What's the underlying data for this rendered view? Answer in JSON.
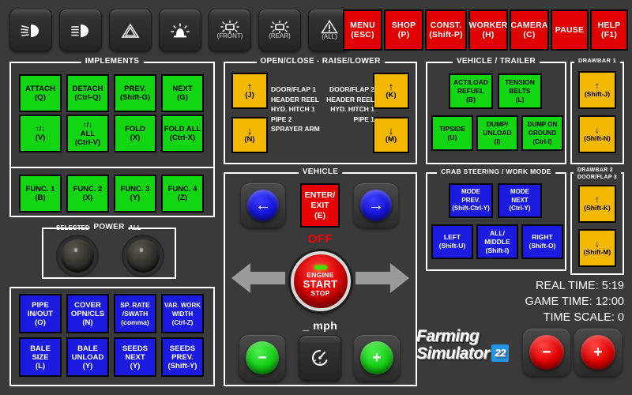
{
  "topbar": {
    "light_buttons": [
      {
        "icon": "low-beam-light-icon",
        "label": ""
      },
      {
        "icon": "high-beam-light-icon",
        "label": ""
      },
      {
        "icon": "hazard-triangle-icon",
        "label": ""
      },
      {
        "icon": "beacon-light-icon",
        "label": ""
      },
      {
        "icon": "work-light-icon",
        "label": "(FRONT)"
      },
      {
        "icon": "work-light-icon",
        "label": "(REAR)"
      },
      {
        "icon": "warning-triangle-icon",
        "label": "(ALL)"
      }
    ],
    "red_buttons": [
      {
        "line1": "MENU",
        "line2": "(ESC)"
      },
      {
        "line1": "SHOP",
        "line2": "(P)"
      },
      {
        "line1": "CONST.",
        "line2": "(Shift-P)"
      },
      {
        "line1": "WORKER",
        "line2": "(H)"
      },
      {
        "line1": "CAMERA",
        "line2": "(C)"
      },
      {
        "line1": "PAUSE",
        "line2": ""
      },
      {
        "line1": "HELP",
        "line2": "(F1)"
      }
    ]
  },
  "implements": {
    "title": "IMPLEMENTS",
    "keys": [
      {
        "line1": "ATTACH",
        "line2": "(Q)"
      },
      {
        "line1": "DETACH",
        "line2": "(Ctrl-Q)"
      },
      {
        "line1": "PREV.",
        "line2": "(Shift-G)"
      },
      {
        "line1": "NEXT",
        "line2": "(G)"
      },
      {
        "line1": "↑/↓",
        "line2": "(V)"
      },
      {
        "line1": "↑/↓",
        "line2": "ALL",
        "line3": "(Ctrl-V)"
      },
      {
        "line1": "FOLD",
        "line2": "(X)"
      },
      {
        "line1": "FOLD ALL",
        "line2": "(Ctrl-X)"
      },
      {
        "line1": "FUNC. 1",
        "line2": "(B)"
      },
      {
        "line1": "FUNC. 2",
        "line2": "(X)"
      },
      {
        "line1": "FUNC. 3",
        "line2": "(Y)"
      },
      {
        "line1": "FUNC. 4",
        "line2": "(Z)"
      }
    ]
  },
  "power": {
    "title": "POWER",
    "knob_left_label": "SELECTED",
    "knob_right_label": "ALL"
  },
  "implement_functions": {
    "keys": [
      {
        "line1": "PIPE",
        "line2": "IN/OUT",
        "line3": "(O)"
      },
      {
        "line1": "COVER",
        "line2": "OPN/CLS",
        "line3": "(N)"
      },
      {
        "line1": "SP. RATE",
        "line2": "/SWATH",
        "line3": "(comma)"
      },
      {
        "line1": "VAR. WORK",
        "line2": "WIDTH",
        "line3": "(Ctrl-Z)"
      },
      {
        "line1": "BALE",
        "line2": "SIZE",
        "line3": "(L)"
      },
      {
        "line1": "BALE",
        "line2": "UNLOAD",
        "line3": "(Y)"
      },
      {
        "line1": "SEEDS",
        "line2": "NEXT",
        "line3": "(Y)"
      },
      {
        "line1": "SEEDS",
        "line2": "PREV.",
        "line3": "(Shift-Y)"
      }
    ]
  },
  "openclose": {
    "title": "OPEN/CLOSE - RAISE/LOWER",
    "up_left": {
      "arrow": "↑",
      "key": "(J)"
    },
    "down_left": {
      "arrow": "↓",
      "key": "(N)"
    },
    "up_right": {
      "arrow": "↑",
      "key": "(K)"
    },
    "down_right": {
      "arrow": "↓",
      "key": "(M)"
    },
    "list_left": [
      "DOOR/FLAP 1",
      "HEADER REEL",
      "HYD. HITCH 1",
      "PIPE 2",
      "SPRAYER ARM"
    ],
    "list_right": [
      "DOOR/FLAP 2",
      "HEADER REEL",
      "HYD. HITCH 1",
      "PIPE 1"
    ]
  },
  "vehicle": {
    "title": "VEHICLE",
    "prev_arrow": "←",
    "next_arrow": "→",
    "enter_exit": {
      "line1": "ENTER/",
      "line2": "EXIT",
      "line3": "(E)"
    },
    "engine_state": "OFF",
    "engine": {
      "line1": "ENGINE",
      "line2": "START",
      "line3": "STOP"
    },
    "speed_value": "_ mph",
    "cruise_icon": "cruise-control-icon",
    "minus": "−",
    "plus": "+"
  },
  "vehicle_trailer": {
    "title": "VEHICLE / TRAILER",
    "keys": [
      {
        "line1": "ACT/LOAD",
        "line2": "REFUEL",
        "line3": "(B)"
      },
      {
        "line1": "TENSION",
        "line2": "BELTS",
        "line3": "(L)"
      },
      {
        "line1": "TIPSIDE",
        "line2": "(U)",
        "line3": ""
      },
      {
        "line1": "DUMP/",
        "line2": "UNLOAD",
        "line3": "(I)"
      },
      {
        "line1": "DUMP ON",
        "line2": "GROUND",
        "line3": "(Ctrl-I)"
      }
    ]
  },
  "crab_steering": {
    "title": "CRAB STEERING / WORK MODE",
    "keys": [
      {
        "line1": "MODE",
        "line2": "PREV.",
        "line3": "(Shift-Ctrl-Y)"
      },
      {
        "line1": "MODE",
        "line2": "NEXT",
        "line3": "(Ctrl-Y)"
      },
      {
        "line1": "LEFT",
        "line2": "(Shift-U)",
        "line3": ""
      },
      {
        "line1": "ALL/",
        "line2": "MIDDLE",
        "line3": "(Shift-I)"
      },
      {
        "line1": "RIGHT",
        "line2": "(Shift-O)",
        "line3": ""
      }
    ]
  },
  "drawbar1": {
    "title": "DRAWBAR 1",
    "up": {
      "arrow": "↑",
      "key": "(Shift-J)"
    },
    "down": {
      "arrow": "↓",
      "key": "(Shift-N)"
    }
  },
  "drawbar2": {
    "title_line1": "DRAWBAR 2",
    "title_line2": "DOOR/FLAP 3",
    "up": {
      "arrow": "↑",
      "key": "(Shift-K)"
    },
    "down": {
      "arrow": "↓",
      "key": "(Shift-M)"
    }
  },
  "status": {
    "real_time": "REAL TIME: 5:19",
    "game_time": "GAME TIME: 12:00",
    "time_scale": "TIME SCALE:    0",
    "minus": "−",
    "plus": "+"
  },
  "brand": {
    "line1": "Farming",
    "line2": "Simulator",
    "badge": "22"
  },
  "colors": {
    "background": "#3a3a3a",
    "green": "#13d613",
    "blue": "#1a1ae0",
    "yellow": "#f5b800",
    "red": "#e80000",
    "panel_border": "#ffffff"
  }
}
